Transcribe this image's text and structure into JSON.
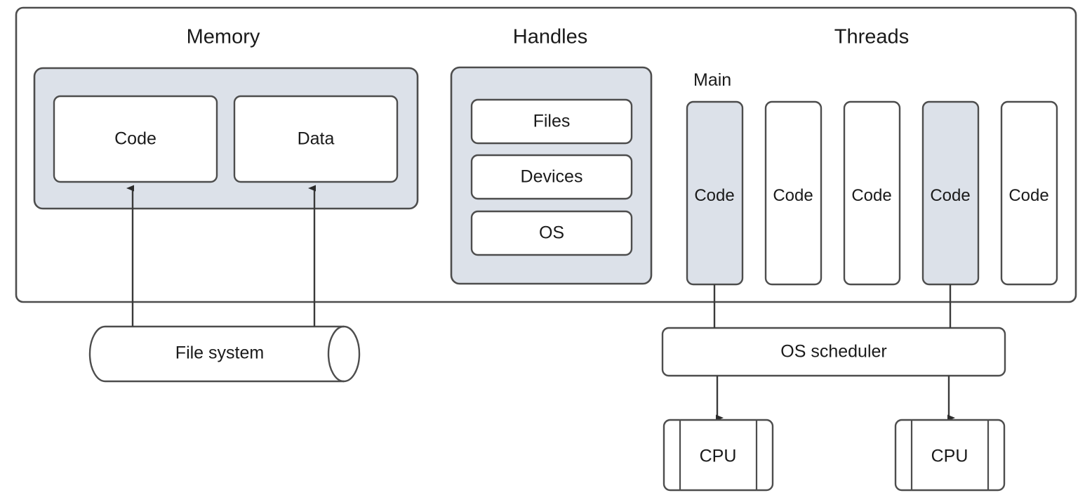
{
  "diagram": {
    "title_partial_cropped": "",
    "process_container": {
      "name": "process-container"
    },
    "sections": [
      {
        "id": "memory",
        "label": "Memory"
      },
      {
        "id": "handles",
        "label": "Handles"
      },
      {
        "id": "threads",
        "label": "Threads"
      }
    ],
    "memory": {
      "label": "Memory",
      "group_fill": "#dce1e9",
      "items": [
        {
          "label": "Code",
          "fill": "#ffffff"
        },
        {
          "label": "Data",
          "fill": "#ffffff"
        }
      ]
    },
    "handles": {
      "label": "Handles",
      "group_fill": "#dce1e9",
      "items": [
        {
          "label": "Files",
          "fill": "#ffffff"
        },
        {
          "label": "Devices",
          "fill": "#ffffff"
        },
        {
          "label": "OS",
          "fill": "#ffffff"
        }
      ]
    },
    "threads": {
      "label": "Threads",
      "main_label": "Main",
      "items": [
        {
          "label": "Code",
          "fill": "#dce1e9",
          "active": true,
          "scheduled": true
        },
        {
          "label": "Code",
          "fill": "#ffffff",
          "active": false,
          "scheduled": false
        },
        {
          "label": "Code",
          "fill": "#ffffff",
          "active": false,
          "scheduled": false
        },
        {
          "label": "Code",
          "fill": "#dce1e9",
          "active": true,
          "scheduled": true
        },
        {
          "label": "Code",
          "fill": "#ffffff",
          "active": false,
          "scheduled": false
        }
      ]
    },
    "file_system": {
      "label": "File system",
      "shape": "cylinder",
      "fill": "#ffffff"
    },
    "scheduler": {
      "label": "OS scheduler",
      "fill": "#ffffff"
    },
    "cpus": [
      {
        "label": "CPU",
        "fill": "#ffffff"
      },
      {
        "label": "CPU",
        "fill": "#ffffff"
      }
    ],
    "arrows": [
      {
        "id": "fs-to-code",
        "from": "file-system",
        "to": "memory-code",
        "direction": "up"
      },
      {
        "id": "fs-to-data",
        "from": "file-system",
        "to": "memory-data",
        "direction": "up"
      },
      {
        "id": "thread1-to-scheduler",
        "from": "thread-1",
        "to": "os-scheduler",
        "direction": "down"
      },
      {
        "id": "thread4-to-scheduler",
        "from": "thread-4",
        "to": "os-scheduler",
        "direction": "down"
      },
      {
        "id": "scheduler-to-cpu1",
        "from": "os-scheduler",
        "to": "cpu-1",
        "direction": "down"
      },
      {
        "id": "scheduler-to-cpu2",
        "from": "os-scheduler",
        "to": "cpu-2",
        "direction": "down"
      }
    ],
    "colors": {
      "stroke": "#4d4d4d",
      "group_fill": "#dce1e9",
      "box_fill": "#ffffff",
      "text": "#1a1a1a",
      "background": "#ffffff"
    }
  }
}
